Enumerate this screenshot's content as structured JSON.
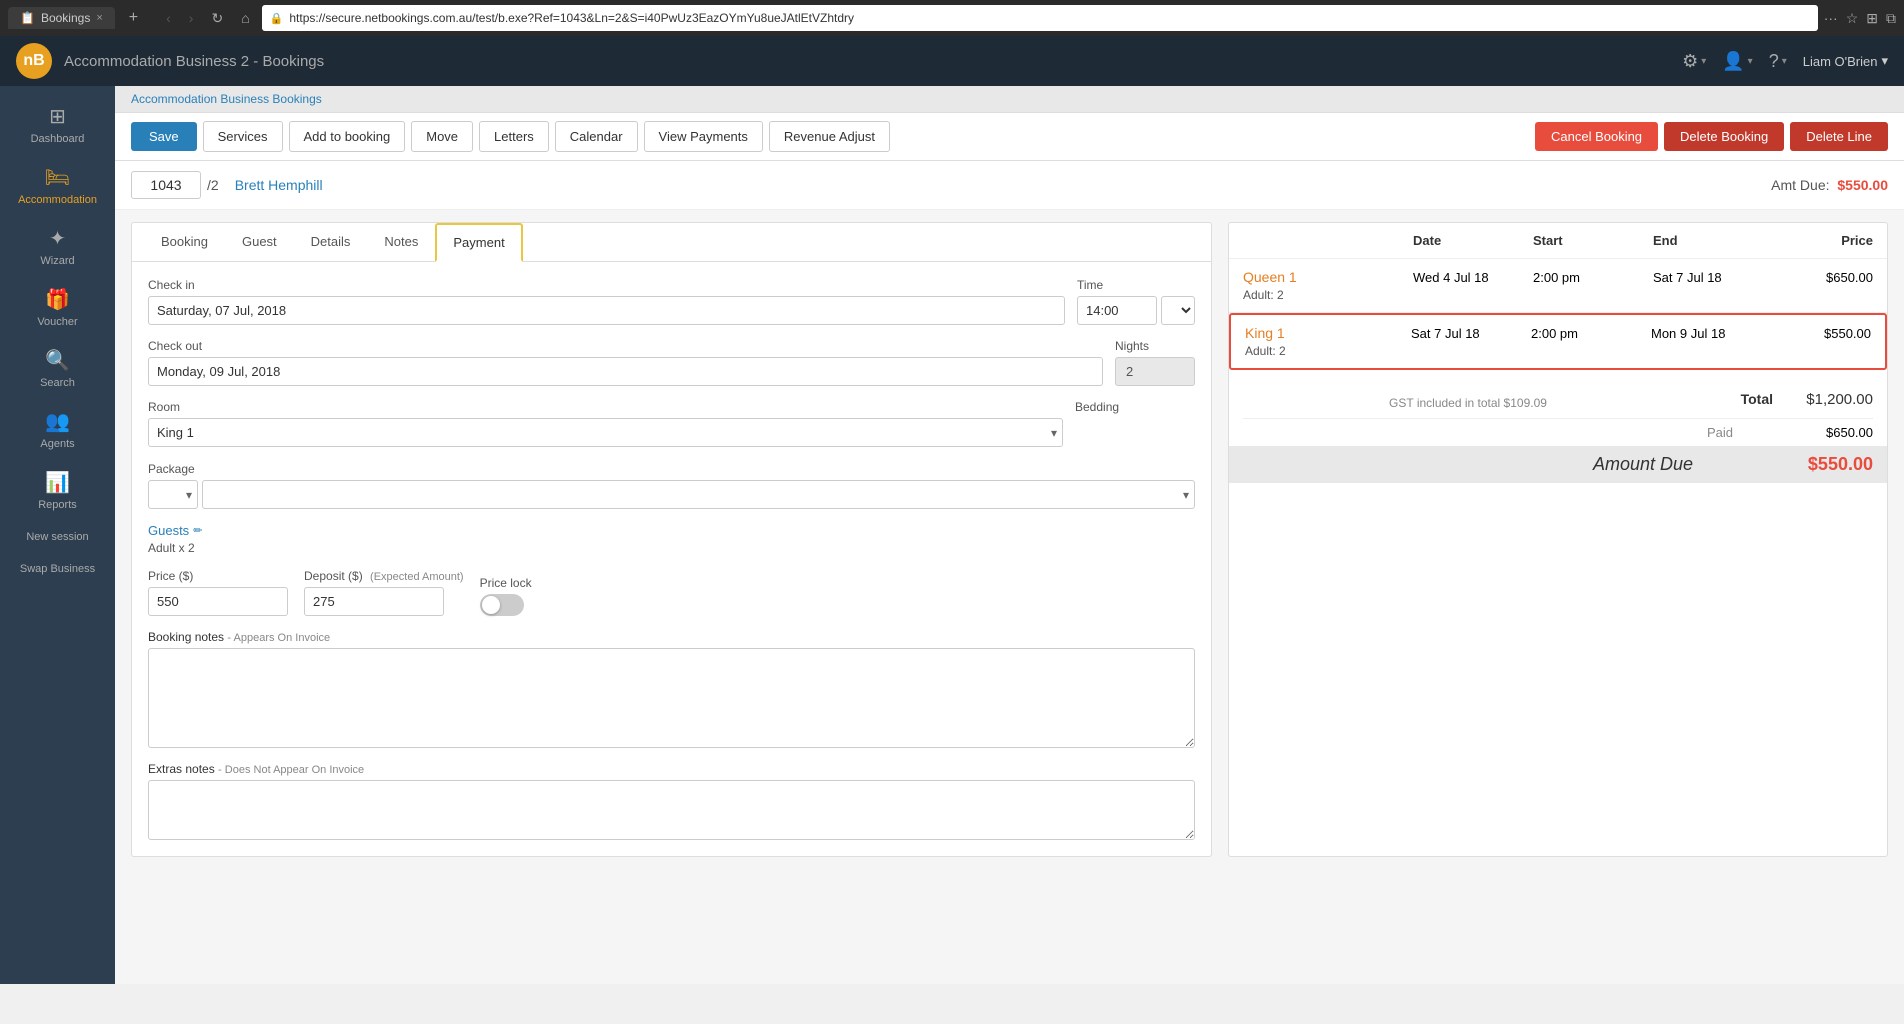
{
  "browser": {
    "tab_title": "Bookings",
    "close_icon": "×",
    "new_tab_icon": "+",
    "url": "https://secure.netbookings.com.au/test/b.exe?Ref=1043&Ln=2&S=i40PwUz3EazOYmYu8ueJAtlEtVZhtdry",
    "back_icon": "‹",
    "forward_icon": "›",
    "refresh_icon": "↻",
    "home_icon": "⌂",
    "more_icon": "···",
    "bookmark_icon": "☆",
    "extensions_icon": "⊞",
    "windows_icon": "⧉"
  },
  "header": {
    "logo_text": "nB",
    "app_name": "Accommodation Business 2",
    "section": "Bookings",
    "settings_icon": "⚙",
    "user_icon": "👤",
    "help_icon": "?",
    "user_name": "Liam O'Brien",
    "caret": "▾"
  },
  "breadcrumb": "Accommodation Business Bookings",
  "toolbar": {
    "save_label": "Save",
    "services_label": "Services",
    "add_to_booking_label": "Add to booking",
    "move_label": "Move",
    "letters_label": "Letters",
    "calendar_label": "Calendar",
    "view_payments_label": "View Payments",
    "revenue_adjust_label": "Revenue Adjust",
    "cancel_booking_label": "Cancel Booking",
    "delete_booking_label": "Delete Booking",
    "delete_line_label": "Delete Line"
  },
  "booking": {
    "id": "1043",
    "total_pages": "/2",
    "guest_name": "Brett Hemphill",
    "amt_due_label": "Amt Due:",
    "amt_due_value": "$550.00"
  },
  "tabs": {
    "booking": "Booking",
    "guest": "Guest",
    "details": "Details",
    "notes": "Notes",
    "payment": "Payment"
  },
  "form": {
    "check_in_label": "Check in",
    "check_in_value": "Saturday, 07 Jul, 2018",
    "time_label": "Time",
    "time_value": "14:00",
    "check_out_label": "Check out",
    "check_out_value": "Monday, 09 Jul, 2018",
    "nights_label": "Nights",
    "nights_value": "2",
    "room_label": "Room",
    "room_value": "King 1",
    "bedding_label": "Bedding",
    "package_label": "Package",
    "guests_heading": "Guests",
    "guests_count": "Adult x 2",
    "price_label": "Price ($)",
    "price_value": "550",
    "deposit_label": "Deposit ($)",
    "deposit_sublabel": "(Expected Amount)",
    "deposit_value": "275",
    "price_lock_label": "Price lock",
    "booking_notes_label": "Booking notes",
    "booking_notes_sublabel": "- Appears On Invoice",
    "booking_notes_value": "",
    "extras_notes_label": "Extras notes",
    "extras_notes_sublabel": "- Does Not Appear On Invoice"
  },
  "booking_entries": [
    {
      "room_name": "Queen 1",
      "adults": "Adult: 2",
      "date": "Wed 4 Jul 18",
      "start": "2:00 pm",
      "end": "Sat 7 Jul 18",
      "price": "$650.00",
      "selected": false
    },
    {
      "room_name": "King 1",
      "adults": "Adult: 2",
      "date": "Sat 7 Jul 18",
      "start": "2:00 pm",
      "end": "Mon 9 Jul 18",
      "price": "$550.00",
      "selected": true
    }
  ],
  "summary": {
    "gst_note": "GST included in total $109.09",
    "total_label": "Total",
    "total_value": "$1,200.00",
    "paid_label": "Paid",
    "paid_value": "$650.00",
    "amount_due_label": "Amount Due",
    "amount_due_value": "$550.00"
  },
  "sidebar": {
    "items": [
      {
        "id": "dashboard",
        "icon": "⊞",
        "label": "Dashboard"
      },
      {
        "id": "accommodation",
        "icon": "🛏",
        "label": "Accommodation"
      },
      {
        "id": "wizard",
        "icon": "✦",
        "label": "Wizard"
      },
      {
        "id": "voucher",
        "icon": "🎁",
        "label": "Voucher"
      },
      {
        "id": "search",
        "icon": "🔍",
        "label": "Search"
      },
      {
        "id": "agents",
        "icon": "👥",
        "label": "Agents"
      },
      {
        "id": "reports",
        "icon": "📊",
        "label": "Reports"
      }
    ],
    "new_session_label": "New session",
    "swap_business_label": "Swap Business"
  }
}
